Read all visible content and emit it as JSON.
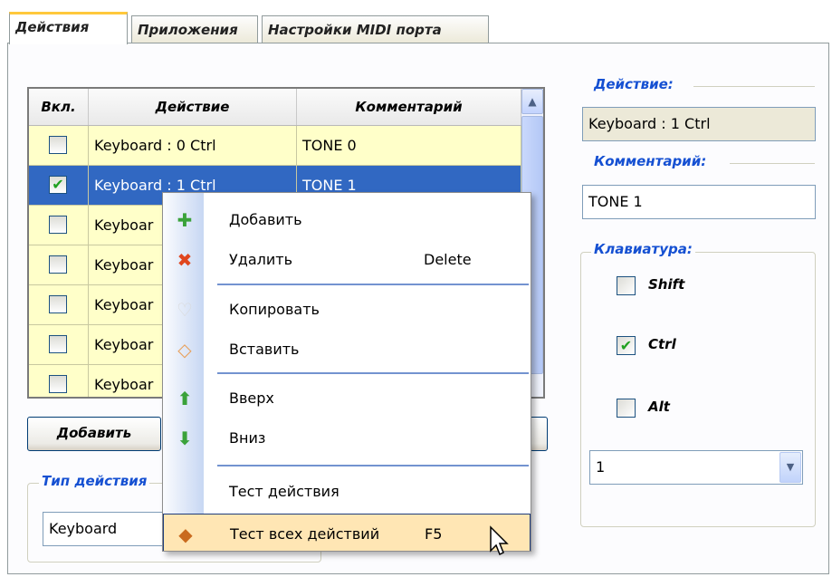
{
  "tabs": [
    {
      "label": "Действия",
      "active": true
    },
    {
      "label": "Приложения",
      "active": false
    },
    {
      "label": "Настройки MIDI порта",
      "active": false
    }
  ],
  "grid": {
    "headers": [
      "Вкл.",
      "Действие",
      "Комментарий"
    ],
    "rows": [
      {
        "checked": false,
        "action": "Keyboard : 0  Ctrl",
        "comment": "TONE 0",
        "selected": false
      },
      {
        "checked": true,
        "action": "Keyboard : 1  Ctrl",
        "comment": "TONE 1",
        "selected": true
      },
      {
        "checked": false,
        "action": "Keyboar",
        "comment": "",
        "selected": false
      },
      {
        "checked": false,
        "action": "Keyboar",
        "comment": "",
        "selected": false
      },
      {
        "checked": false,
        "action": "Keyboar",
        "comment": "",
        "selected": false
      },
      {
        "checked": false,
        "action": "Keyboar",
        "comment": "",
        "selected": false
      },
      {
        "checked": false,
        "action": "Keyboar",
        "comment": "",
        "selected": false
      }
    ]
  },
  "buttons": {
    "add": "Добавить"
  },
  "action_type": {
    "label": "Тип действия",
    "value": "Keyboard"
  },
  "right_panel": {
    "action_label": "Действие:",
    "action_value": "Keyboard : 1  Ctrl",
    "comment_label": "Комментарий:",
    "comment_value": "TONE 1",
    "keyboard_label": "Клавиатура:",
    "shift": {
      "label": "Shift",
      "checked": false
    },
    "ctrl": {
      "label": "Ctrl",
      "checked": true
    },
    "alt": {
      "label": "Alt",
      "checked": false
    },
    "key_select": "1"
  },
  "context_menu": {
    "items": [
      {
        "label": "Добавить",
        "shortcut": "",
        "icon": "plus-icon",
        "color": "#3aa23a"
      },
      {
        "label": "Удалить",
        "shortcut": "Delete",
        "icon": "delete-x-icon",
        "color": "#e0461e"
      },
      {
        "label": "Копировать",
        "shortcut": "",
        "icon": "copy-icon",
        "color": "#d8d8d8"
      },
      {
        "label": "Вставить",
        "shortcut": "",
        "icon": "paste-icon",
        "color": "#e8a05a"
      },
      {
        "label": "Вверх",
        "shortcut": "",
        "icon": "arrow-up-icon",
        "color": "#3aa23a"
      },
      {
        "label": "Вниз",
        "shortcut": "",
        "icon": "arrow-down-icon",
        "color": "#3aa23a"
      },
      {
        "label": "Тест действия",
        "shortcut": "",
        "icon": "",
        "color": ""
      },
      {
        "label": "Тест всех действий",
        "shortcut": "F5",
        "icon": "diamond-icon",
        "color": "#c96a1e"
      }
    ],
    "highlighted_index": 7
  },
  "colors": {
    "selection": "#3168c2",
    "row_bg": "#ffffc9",
    "group_label": "#1550d2",
    "menu_highlight": "#ffe6b4"
  }
}
